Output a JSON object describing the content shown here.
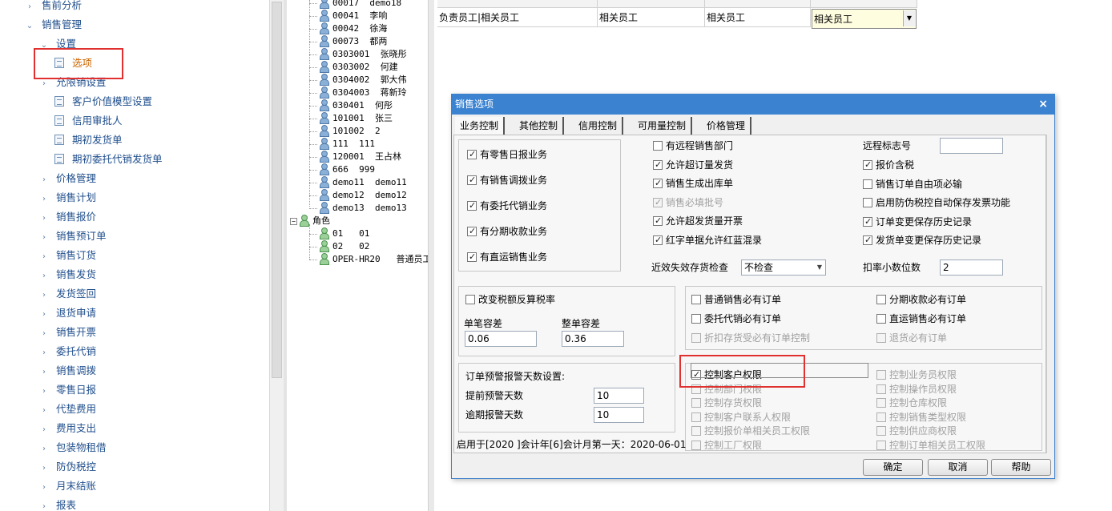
{
  "nav": {
    "items": [
      {
        "label": "售前分析",
        "level": 0,
        "chev": "›",
        "type": "group"
      },
      {
        "label": "销售管理",
        "level": 0,
        "chev": "⌄",
        "type": "group"
      },
      {
        "label": "设置",
        "level": 1,
        "chev": "⌄",
        "type": "group"
      },
      {
        "label": "选项",
        "level": 2,
        "type": "doc",
        "selected": true
      },
      {
        "label": "允限销设置",
        "level": 1,
        "chev": "›",
        "type": "group"
      },
      {
        "label": "客户价值模型设置",
        "level": 2,
        "type": "doc"
      },
      {
        "label": "信用审批人",
        "level": 2,
        "type": "doc"
      },
      {
        "label": "期初发货单",
        "level": 2,
        "type": "doc"
      },
      {
        "label": "期初委托代销发货单",
        "level": 2,
        "type": "doc"
      },
      {
        "label": "价格管理",
        "level": 1,
        "chev": "›",
        "type": "group"
      },
      {
        "label": "销售计划",
        "level": 1,
        "chev": "›",
        "type": "group"
      },
      {
        "label": "销售报价",
        "level": 1,
        "chev": "›",
        "type": "group"
      },
      {
        "label": "销售预订单",
        "level": 1,
        "chev": "›",
        "type": "group"
      },
      {
        "label": "销售订货",
        "level": 1,
        "chev": "›",
        "type": "group"
      },
      {
        "label": "销售发货",
        "level": 1,
        "chev": "›",
        "type": "group"
      },
      {
        "label": "发货签回",
        "level": 1,
        "chev": "›",
        "type": "group"
      },
      {
        "label": "退货申请",
        "level": 1,
        "chev": "›",
        "type": "group"
      },
      {
        "label": "销售开票",
        "level": 1,
        "chev": "›",
        "type": "group"
      },
      {
        "label": "委托代销",
        "level": 1,
        "chev": "›",
        "type": "group"
      },
      {
        "label": "销售调拨",
        "level": 1,
        "chev": "›",
        "type": "group"
      },
      {
        "label": "零售日报",
        "level": 1,
        "chev": "›",
        "type": "group"
      },
      {
        "label": "代垫费用",
        "level": 1,
        "chev": "›",
        "type": "group"
      },
      {
        "label": "费用支出",
        "level": 1,
        "chev": "›",
        "type": "group"
      },
      {
        "label": "包装物租借",
        "level": 1,
        "chev": "›",
        "type": "group"
      },
      {
        "label": "防伪税控",
        "level": 1,
        "chev": "›",
        "type": "group"
      },
      {
        "label": "月末结账",
        "level": 1,
        "chev": "›",
        "type": "group"
      },
      {
        "label": "报表",
        "level": 1,
        "chev": "›",
        "type": "group"
      }
    ]
  },
  "tree": {
    "users": [
      {
        "code": "00017",
        "name": "demo18"
      },
      {
        "code": "00041",
        "name": "李响"
      },
      {
        "code": "00042",
        "name": "徐海"
      },
      {
        "code": "00073",
        "name": "都两"
      },
      {
        "code": "0303001",
        "name": "张晓彤"
      },
      {
        "code": "0303002",
        "name": "何建"
      },
      {
        "code": "0304002",
        "name": "郭大伟"
      },
      {
        "code": "0304003",
        "name": "蒋新玲"
      },
      {
        "code": "030401",
        "name": "何彤"
      },
      {
        "code": "101001",
        "name": "张三"
      },
      {
        "code": "101002",
        "name": "2"
      },
      {
        "code": "111",
        "name": "111"
      },
      {
        "code": "120001",
        "name": "王占林"
      },
      {
        "code": "666",
        "name": "999"
      },
      {
        "code": "demo11",
        "name": "demo11"
      },
      {
        "code": "demo12",
        "name": "demo12"
      },
      {
        "code": "demo13",
        "name": "demo13"
      }
    ],
    "role_group": {
      "expander": "−",
      "label": "角色"
    },
    "roles": [
      {
        "code": "01",
        "name": "01"
      },
      {
        "code": "02",
        "name": "02"
      },
      {
        "code": "OPER-HR20",
        "name": "普通员工"
      }
    ]
  },
  "grid": {
    "row": [
      "负责员工|相关员工",
      "相关员工",
      "相关员工"
    ],
    "combo_value": "相关员工",
    "combo_arrow": "▼"
  },
  "dialog": {
    "title": "销售选项",
    "close": "×",
    "tabs": [
      "业务控制",
      "其他控制",
      "信用控制",
      "可用量控制",
      "价格管理"
    ],
    "business": [
      {
        "label": "有零售日报业务",
        "checked": true
      },
      {
        "label": "有销售调拨业务",
        "checked": true
      },
      {
        "label": "有委托代销业务",
        "checked": true
      },
      {
        "label": "有分期收款业务",
        "checked": true
      },
      {
        "label": "有直运销售业务",
        "checked": true
      }
    ],
    "mid_options": [
      {
        "label": "有远程销售部门",
        "checked": false,
        "disabled": false
      },
      {
        "label": "允许超订量发货",
        "checked": true,
        "disabled": false
      },
      {
        "label": "销售生成出库单",
        "checked": true,
        "disabled": false
      },
      {
        "label": "销售必填批号",
        "checked": true,
        "disabled": true
      },
      {
        "label": "允许超发货量开票",
        "checked": true,
        "disabled": false
      },
      {
        "label": "红字单据允许红蓝混录",
        "checked": true,
        "disabled": false
      }
    ],
    "remote_label": "远程标志号",
    "remote_value": "",
    "right_options": [
      {
        "label": "报价含税",
        "checked": true
      },
      {
        "label": "销售订单自由项必输",
        "checked": false
      },
      {
        "label": "启用防伪税控自动保存发票功能",
        "checked": false
      },
      {
        "label": "订单变更保存历史记录",
        "checked": true
      },
      {
        "label": "发货单变更保存历史记录",
        "checked": true
      }
    ],
    "expiry_label": "近效失效存货检查",
    "expiry_value": "不检查",
    "expiry_arrow": "▼",
    "discount_label": "扣率小数位数",
    "discount_value": "2",
    "tax": {
      "checkbox_label": "改变税额反算税率",
      "checked": false,
      "single_label": "单笔容差",
      "single_value": "0.06",
      "whole_label": "整单容差",
      "whole_value": "0.36"
    },
    "order_required": [
      {
        "label": "普通销售必有订单",
        "checked": false,
        "disabled": false
      },
      {
        "label": "分期收款必有订单",
        "checked": false,
        "disabled": false
      },
      {
        "label": "委托代销必有订单",
        "checked": false,
        "disabled": false
      },
      {
        "label": "直运销售必有订单",
        "checked": false,
        "disabled": false
      },
      {
        "label": "折扣存货受必有订单控制",
        "checked": false,
        "disabled": true
      },
      {
        "label": "退货必有订单",
        "checked": false,
        "disabled": true
      }
    ],
    "warning": {
      "title": "订单预警报警天数设置:",
      "advance_label": "提前预警天数",
      "advance_value": "10",
      "overdue_label": "逾期报警天数",
      "overdue_value": "10"
    },
    "footer_text": "启用于[2020 ]会计年[6]会计月第一天：2020-06-01",
    "permissions_left": [
      {
        "label": "控制客户权限",
        "checked": true,
        "disabled": false
      },
      {
        "label": "控制部门权限",
        "checked": false,
        "disabled": true
      },
      {
        "label": "控制存货权限",
        "checked": false,
        "disabled": true
      },
      {
        "label": "控制客户联系人权限",
        "checked": false,
        "disabled": true
      },
      {
        "label": "控制报价单相关员工权限",
        "checked": false,
        "disabled": true
      },
      {
        "label": "控制工厂权限",
        "checked": false,
        "disabled": true
      }
    ],
    "permissions_right": [
      {
        "label": "控制业务员权限",
        "checked": false,
        "disabled": true
      },
      {
        "label": "控制操作员权限",
        "checked": false,
        "disabled": true
      },
      {
        "label": "控制仓库权限",
        "checked": false,
        "disabled": true
      },
      {
        "label": "控制销售类型权限",
        "checked": false,
        "disabled": true
      },
      {
        "label": "控制供应商权限",
        "checked": false,
        "disabled": true
      },
      {
        "label": "控制订单相关员工权限",
        "checked": false,
        "disabled": true
      }
    ],
    "buttons": {
      "ok": "确定",
      "cancel": "取消",
      "help": "帮助"
    }
  }
}
